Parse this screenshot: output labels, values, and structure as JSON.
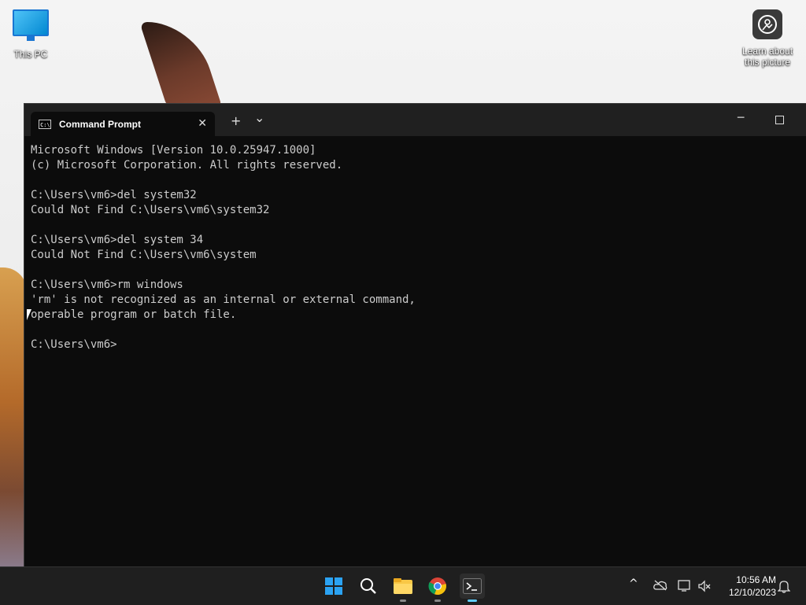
{
  "desktop": {
    "icons": [
      {
        "label": "This PC"
      },
      {
        "label": "Learn about\nthis picture"
      }
    ]
  },
  "window": {
    "tab_title": "Command Prompt",
    "tab_close": "✕",
    "new_tab": "+",
    "dropdown": "⌄",
    "minimize": "─",
    "console_lines": [
      "Microsoft Windows [Version 10.0.25947.1000]",
      "(c) Microsoft Corporation. All rights reserved.",
      "",
      "C:\\Users\\vm6>del system32",
      "Could Not Find C:\\Users\\vm6\\system32",
      "",
      "C:\\Users\\vm6>del system 34",
      "Could Not Find C:\\Users\\vm6\\system",
      "",
      "C:\\Users\\vm6>rm windows",
      "'rm' is not recognized as an internal or external command,",
      "operable program or batch file.",
      "",
      "C:\\Users\\vm6>"
    ]
  },
  "taskbar": {
    "apps": [
      "start-icon",
      "search-icon",
      "file-explorer-icon",
      "chrome-icon",
      "terminal-icon"
    ],
    "tray": {
      "chevron": "^",
      "time": "10:56 AM",
      "date": "12/10/2023"
    }
  }
}
